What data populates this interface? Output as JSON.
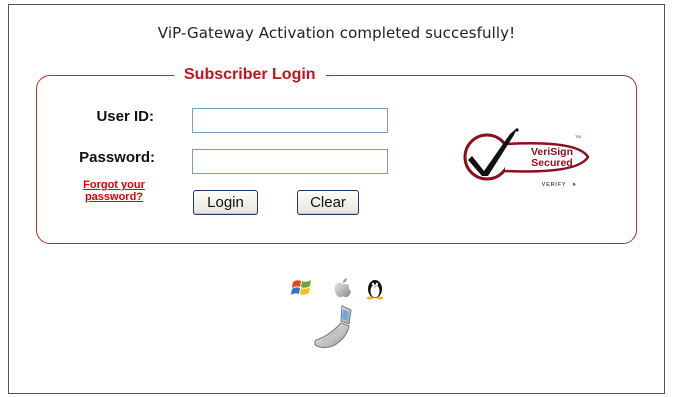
{
  "status": {
    "message": "ViP-Gateway Activation completed succesfully!"
  },
  "login": {
    "legend": "Subscriber Login",
    "user_id_label": "User ID:",
    "user_id_value": "",
    "password_label": "Password:",
    "password_value": "",
    "forgot_line1": "Forgot your",
    "forgot_line2": "password?",
    "login_button": "Login",
    "clear_button": "Clear"
  },
  "seal": {
    "brand_line1": "VeriSign",
    "brand_line2": "Secured",
    "verify": "VERIFY",
    "trademark": "TM",
    "icon": "verisign-secured-seal"
  },
  "platforms": {
    "icons": [
      "windows-icon",
      "apple-icon",
      "linux-tux-icon",
      "mobile-phone-icon"
    ]
  },
  "colors": {
    "accent_red": "#c0141a",
    "border_red": "#b03030",
    "input_border": "#7f9db9",
    "button_border": "#1d3a6e"
  }
}
